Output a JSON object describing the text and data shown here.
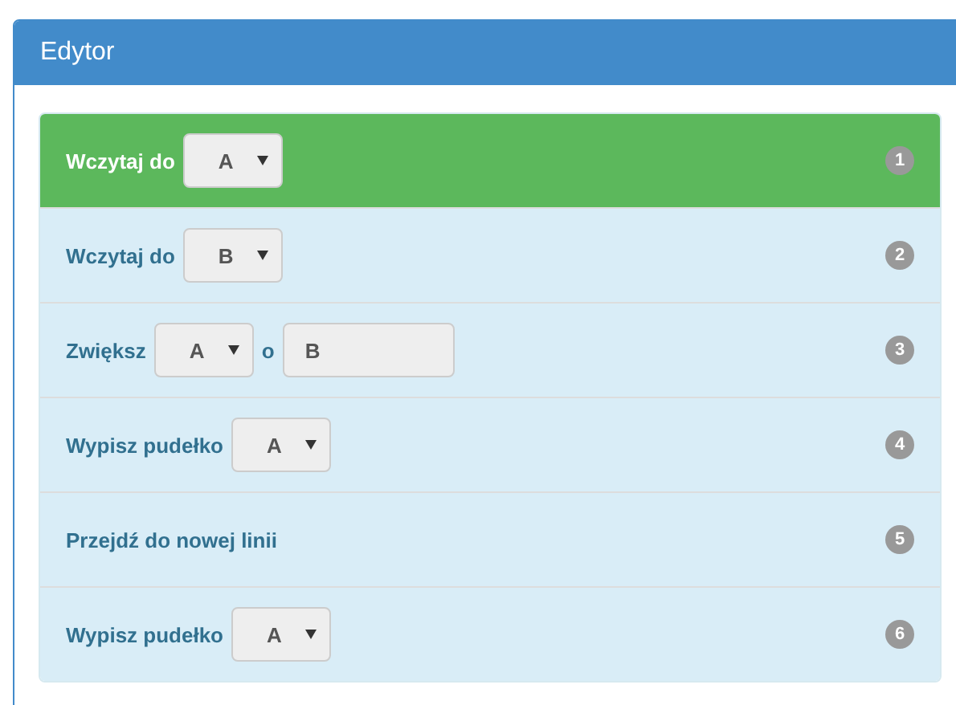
{
  "panel": {
    "title": "Edytor"
  },
  "rows": [
    {
      "selected": true,
      "badge": "1",
      "parts": [
        {
          "kind": "text",
          "text": "Wczytaj do"
        },
        {
          "kind": "select",
          "value": "A"
        }
      ]
    },
    {
      "selected": false,
      "badge": "2",
      "parts": [
        {
          "kind": "text",
          "text": "Wczytaj do"
        },
        {
          "kind": "select",
          "value": "B"
        }
      ]
    },
    {
      "selected": false,
      "badge": "3",
      "parts": [
        {
          "kind": "text",
          "text": "Zwiększ"
        },
        {
          "kind": "select",
          "value": "A"
        },
        {
          "kind": "text",
          "text": "o"
        },
        {
          "kind": "input",
          "value": "B"
        }
      ]
    },
    {
      "selected": false,
      "badge": "4",
      "parts": [
        {
          "kind": "text",
          "text": "Wypisz pudełko"
        },
        {
          "kind": "select",
          "value": "A"
        }
      ]
    },
    {
      "selected": false,
      "badge": "5",
      "parts": [
        {
          "kind": "text",
          "text": "Przejdź do nowej linii"
        }
      ]
    },
    {
      "selected": false,
      "badge": "6",
      "parts": [
        {
          "kind": "text",
          "text": "Wypisz pudełko"
        },
        {
          "kind": "select",
          "value": "A"
        }
      ]
    }
  ]
}
